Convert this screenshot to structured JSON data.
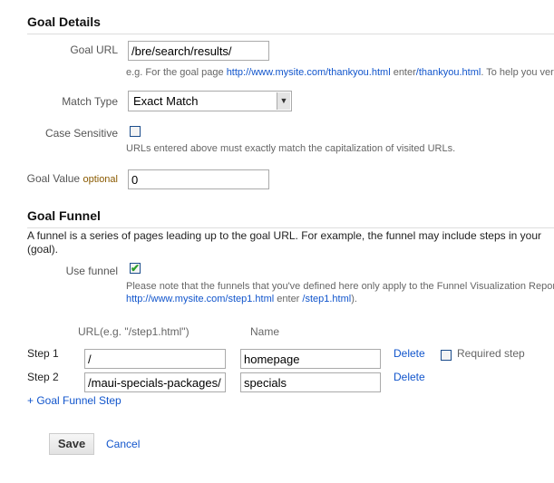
{
  "goal_details": {
    "heading": "Goal Details",
    "goal_url": {
      "label": "Goal URL",
      "value": "/bre/search/results/",
      "help_prefix": "e.g. For the goal page ",
      "help_link1": "http://www.mysite.com/thankyou.html",
      "help_mid": " enter",
      "help_link2": "/thankyou.html",
      "help_suffix": ". To help you veri"
    },
    "match_type": {
      "label": "Match Type",
      "selected": "Exact Match"
    },
    "case_sensitive": {
      "label": "Case Sensitive",
      "checked": false,
      "help": "URLs entered above must exactly match the capitalization of visited URLs."
    },
    "goal_value": {
      "label": "Goal Value",
      "optional": "optional",
      "value": "0"
    }
  },
  "goal_funnel": {
    "heading": "Goal Funnel",
    "description_line1": "A funnel is a series of pages leading up to the goal URL. For example, the funnel may include steps in your",
    "description_line2": "(goal).",
    "use_funnel": {
      "label": "Use funnel",
      "checked": true,
      "note": "Please note that the funnels that you've defined here only apply to the Funnel Visualization Report",
      "note_link1": "http://www.mysite.com/step1.html",
      "note_mid": " enter ",
      "note_link2": "/step1.html",
      "note_suffix": ")."
    },
    "col_url": "URL(e.g. \"/step1.html\")",
    "col_name": "Name",
    "steps": [
      {
        "label": "Step 1",
        "url": "/",
        "name": "homepage",
        "delete": "Delete"
      },
      {
        "label": "Step 2",
        "url": "/maui-specials-packages/",
        "name": "specials",
        "delete": "Delete"
      }
    ],
    "required_step": {
      "label": "Required step",
      "checked": false
    },
    "add_step": "+ Goal Funnel Step"
  },
  "actions": {
    "save": "Save",
    "cancel": "Cancel"
  },
  "colors": {
    "link": "#1155cc",
    "optional": "#8a5a00",
    "checkmark": "#2a9d2a"
  }
}
